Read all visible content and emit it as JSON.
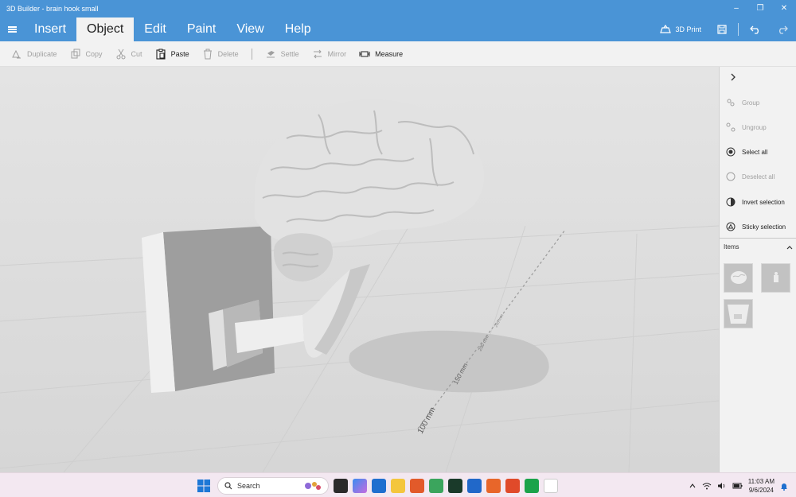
{
  "window": {
    "title": "3D Builder - brain hook small",
    "minimize_glyph": "–",
    "restore_glyph": "❐",
    "close_glyph": "✕"
  },
  "menu": {
    "tabs": [
      {
        "label": "Insert",
        "active": false
      },
      {
        "label": "Object",
        "active": true
      },
      {
        "label": "Edit",
        "active": false
      },
      {
        "label": "Paint",
        "active": false
      },
      {
        "label": "View",
        "active": false
      },
      {
        "label": "Help",
        "active": false
      }
    ],
    "print_label": "3D Print"
  },
  "toolbar": {
    "duplicate": "Duplicate",
    "copy": "Copy",
    "cut": "Cut",
    "paste": "Paste",
    "delete": "Delete",
    "settle": "Settle",
    "mirror": "Mirror",
    "measure": "Measure"
  },
  "viewport": {
    "ruler_labels": [
      "100 mm",
      "150 mm",
      "200 mm",
      "250 mm"
    ]
  },
  "side_panel": {
    "actions": [
      {
        "label": "Group",
        "enabled": false,
        "icon": "group-icon"
      },
      {
        "label": "Ungroup",
        "enabled": false,
        "icon": "ungroup-icon"
      },
      {
        "label": "Select all",
        "enabled": true,
        "icon": "select-all-icon"
      },
      {
        "label": "Deselect all",
        "enabled": false,
        "icon": "deselect-all-icon"
      },
      {
        "label": "Invert selection",
        "enabled": true,
        "icon": "invert-selection-icon"
      },
      {
        "label": "Sticky selection",
        "enabled": true,
        "icon": "sticky-selection-icon"
      }
    ],
    "items_label": "Items"
  },
  "taskbar": {
    "search_placeholder": "Search",
    "time": "11:03 AM",
    "date": "9/6/2024"
  },
  "colors": {
    "accent": "#4a94d6",
    "toolbar_bg": "#f2f2f2",
    "taskbar_bg": "#f3e8f1"
  }
}
